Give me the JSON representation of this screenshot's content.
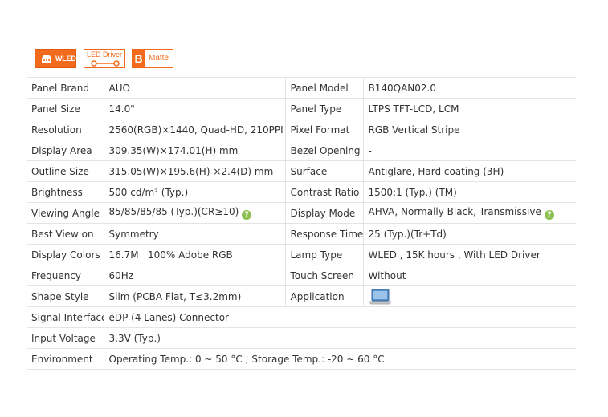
{
  "badges": {
    "wled": "WLED",
    "led_driver": "LED Driver",
    "matte_mark": "B",
    "matte": "Matte"
  },
  "specs": {
    "panel_brand": {
      "label": "Panel Brand",
      "value": "AUO"
    },
    "panel_model": {
      "label": "Panel Model",
      "value": "B140QAN02.0"
    },
    "panel_size": {
      "label": "Panel Size",
      "value": "14.0\""
    },
    "panel_type": {
      "label": "Panel Type",
      "value": "LTPS TFT-LCD, LCM"
    },
    "resolution": {
      "label": "Resolution",
      "value": "2560(RGB)×1440, Quad-HD, 210PPI"
    },
    "pixel_format": {
      "label": "Pixel Format",
      "value": "RGB Vertical Stripe"
    },
    "display_area": {
      "label": "Display Area",
      "value": "309.35(W)×174.01(H) mm"
    },
    "bezel_opening": {
      "label": "Bezel Opening",
      "value": "-"
    },
    "outline_size": {
      "label": "Outline Size",
      "value": "315.05(W)×195.6(H) ×2.4(D) mm"
    },
    "surface": {
      "label": "Surface",
      "value": "Antiglare, Hard coating (3H)"
    },
    "brightness": {
      "label": "Brightness",
      "value": "500 cd/m² (Typ.)"
    },
    "contrast_ratio": {
      "label": "Contrast Ratio",
      "value": "1500:1 (Typ.) (TM)"
    },
    "viewing_angle": {
      "label": "Viewing Angle",
      "value": "85/85/85/85 (Typ.)(CR≥10)"
    },
    "display_mode": {
      "label": "Display Mode",
      "value": "AHVA, Normally Black, Transmissive"
    },
    "best_view_on": {
      "label": "Best View on",
      "value": "Symmetry"
    },
    "response_time": {
      "label": "Response Time",
      "value": "25 (Typ.)(Tr+Td)"
    },
    "display_colors": {
      "label": "Display Colors",
      "value": "16.7M   100% Adobe RGB"
    },
    "lamp_type": {
      "label": "Lamp Type",
      "value": "WLED , 15K hours , With LED Driver"
    },
    "frequency": {
      "label": "Frequency",
      "value": "60Hz"
    },
    "touch_screen": {
      "label": "Touch Screen",
      "value": "Without"
    },
    "shape_style": {
      "label": "Shape Style",
      "value": "Slim (PCBA Flat, T≤3.2mm)"
    },
    "application": {
      "label": "Application",
      "icon": "laptop-icon"
    },
    "signal_interface": {
      "label": "Signal Interface",
      "value": "eDP (4 Lanes) Connector"
    },
    "input_voltage": {
      "label": "Input Voltage",
      "value": "3.3V (Typ.)"
    },
    "environment": {
      "label": "Environment",
      "value": "Operating Temp.: 0 ~ 50 °C ; Storage Temp.: -20 ~ 60 °C"
    }
  },
  "help_icon": "?",
  "colors": {
    "accent": "#f26b1d",
    "help": "#8cc152",
    "border": "#e4e4e4"
  }
}
